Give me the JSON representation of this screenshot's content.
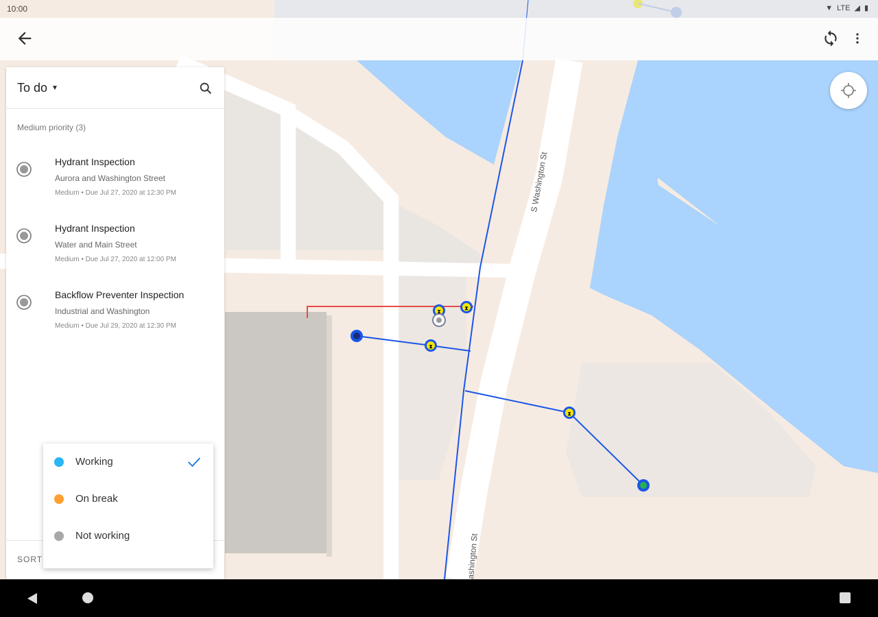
{
  "status_bar": {
    "time": "10:00",
    "network": "LTE"
  },
  "colors": {
    "water": "#aad3fd",
    "land": "#f6ebe2",
    "road": "#ffffff",
    "building": "#e8e6e2",
    "pipe": "#1a56e8",
    "pipe_red": "#e84a4a",
    "asset_yellow": "#f5e600",
    "working": "#29b6f6",
    "on_break": "#ffa033",
    "not_working": "#a8a8a8",
    "accent": "#1a73e8"
  },
  "icons": {
    "back": "arrow-left-icon",
    "sync": "sync-icon",
    "more": "more-vert-icon",
    "search": "search-icon",
    "locate": "crosshair-icon"
  },
  "map": {
    "street_labels": [
      "S Washington St",
      "ashington St"
    ]
  },
  "panel": {
    "filter_label": "To do",
    "section_header": "Medium priority (3)",
    "tasks": [
      {
        "title": "Hydrant Inspection",
        "address": "Aurora and Washington Street",
        "meta": "Medium  •  Due Jul 27, 2020 at 12:30 PM"
      },
      {
        "title": "Hydrant Inspection",
        "address": "Water and Main Street",
        "meta": "Medium  •  Due Jul 27, 2020 at 12:00 PM"
      },
      {
        "title": "Backflow Preventer Inspection",
        "address": "Industrial and Washington",
        "meta": "Medium  •  Due Jul 29, 2020 at 12:30 PM"
      }
    ],
    "sort_label": "SORT"
  },
  "status_menu": {
    "items": [
      {
        "label": "Working",
        "selected": true
      },
      {
        "label": "On break",
        "selected": false
      },
      {
        "label": "Not working",
        "selected": false
      }
    ]
  }
}
